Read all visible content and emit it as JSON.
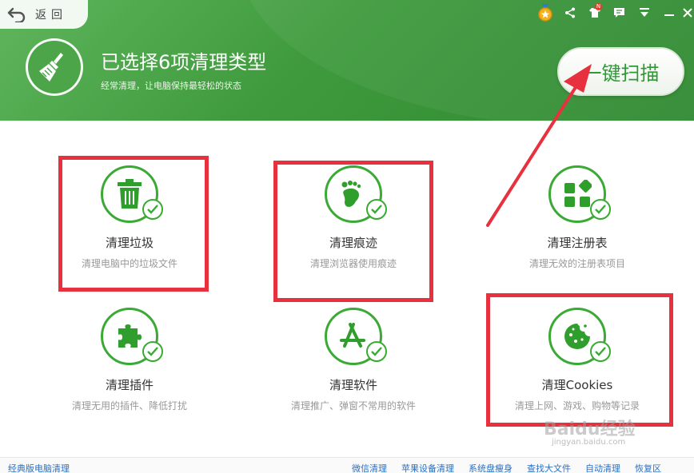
{
  "header": {
    "back_label": "返回",
    "title": "已选择6项清理类型",
    "subtitle": "经常清理，让电脑保持最轻松的状态",
    "scan_button": "一键扫描",
    "badge_letter": "N"
  },
  "items": [
    {
      "title": "清理垃圾",
      "desc": "清理电脑中的垃圾文件",
      "icon": "trash-can-icon",
      "checked": true
    },
    {
      "title": "清理痕迹",
      "desc": "清理浏览器使用痕迹",
      "icon": "footprint-icon",
      "checked": true
    },
    {
      "title": "清理注册表",
      "desc": "清理无效的注册表项目",
      "icon": "registry-blocks-icon",
      "checked": true
    },
    {
      "title": "清理插件",
      "desc": "清理无用的插件、降低打扰",
      "icon": "puzzle-piece-icon",
      "checked": true
    },
    {
      "title": "清理软件",
      "desc": "清理推广、弹窗不常用的软件",
      "icon": "app-store-icon",
      "checked": true
    },
    {
      "title": "清理Cookies",
      "desc": "清理上网、游戏、购物等记录",
      "icon": "cookie-icon",
      "checked": true
    }
  ],
  "footer": {
    "left_link": "经典版电脑清理",
    "links": [
      "微信清理",
      "苹果设备清理",
      "系统盘瘦身",
      "查找大文件",
      "自动清理",
      "恢复区"
    ]
  },
  "watermark": {
    "text": "Baidu经验",
    "sub": "jingyan.baidu.com"
  },
  "colors": {
    "header_green": "#3f9a3d",
    "accent_green": "#3aaa35",
    "annotation_red": "#e8313f",
    "link_blue": "#2a6fc2"
  }
}
